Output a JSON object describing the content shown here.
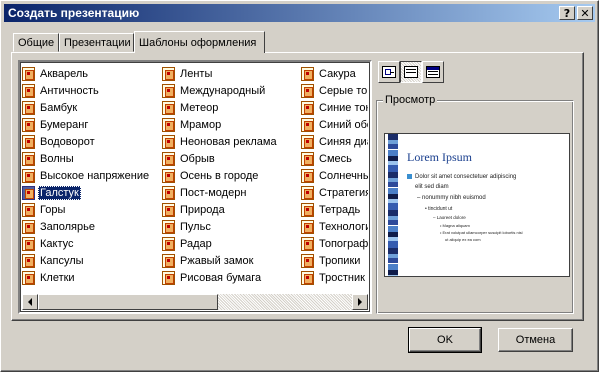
{
  "window": {
    "title": "Создать презентацию",
    "help_label": "?",
    "close_label": "✕"
  },
  "tabs": [
    {
      "label": "Общие",
      "active": false
    },
    {
      "label": "Презентации",
      "active": false
    },
    {
      "label": "Шаблоны оформления",
      "active": true
    }
  ],
  "templates": {
    "selected": "Галстук",
    "columns": [
      [
        "Акварель",
        "Античность",
        "Бамбук",
        "Бумеранг",
        "Водоворот",
        "Волны",
        "Высокое напряжение",
        "Галстук",
        "Горы",
        "Заполярье",
        "Кактус",
        "Капсулы",
        "Клетки"
      ],
      [
        "Ленты",
        "Международный",
        "Метеор",
        "Мрамор",
        "Неоновая реклама",
        "Обрыв",
        "Осень в городе",
        "Пост-модерн",
        "Природа",
        "Пульс",
        "Радар",
        "Ржавый замок",
        "Рисовая бумага"
      ],
      [
        "Сакура",
        "Серые тон",
        "Синие тон",
        "Синий обе",
        "Синяя диа",
        "Смесь",
        "Солнечны",
        "Стратегия",
        "Тетрадь",
        "Технологи",
        "Топографи",
        "Тропики",
        "Тростник"
      ]
    ],
    "item_icon": "presentation-template-icon"
  },
  "view_buttons": [
    {
      "name": "large-icons-view-icon",
      "pressed": false
    },
    {
      "name": "list-view-icon",
      "pressed": true
    },
    {
      "name": "details-view-icon",
      "pressed": false
    }
  ],
  "preview": {
    "label": "Просмотр",
    "slide_title": "Lorem Ipsum",
    "lines": [
      "Dolor sit amet consectetuer adipiscing",
      "elit sed diam",
      "nonummy nibh euismod",
      "tincidunt ut",
      "Laoreet dolore",
      "Magna aliquam",
      "Erat volutpat ullamcorper suscipit lobortis nisl",
      "ut aliquip ex ea com"
    ],
    "accent": "#1a3f8e"
  },
  "buttons": {
    "ok": "OK",
    "cancel": "Отмена"
  }
}
